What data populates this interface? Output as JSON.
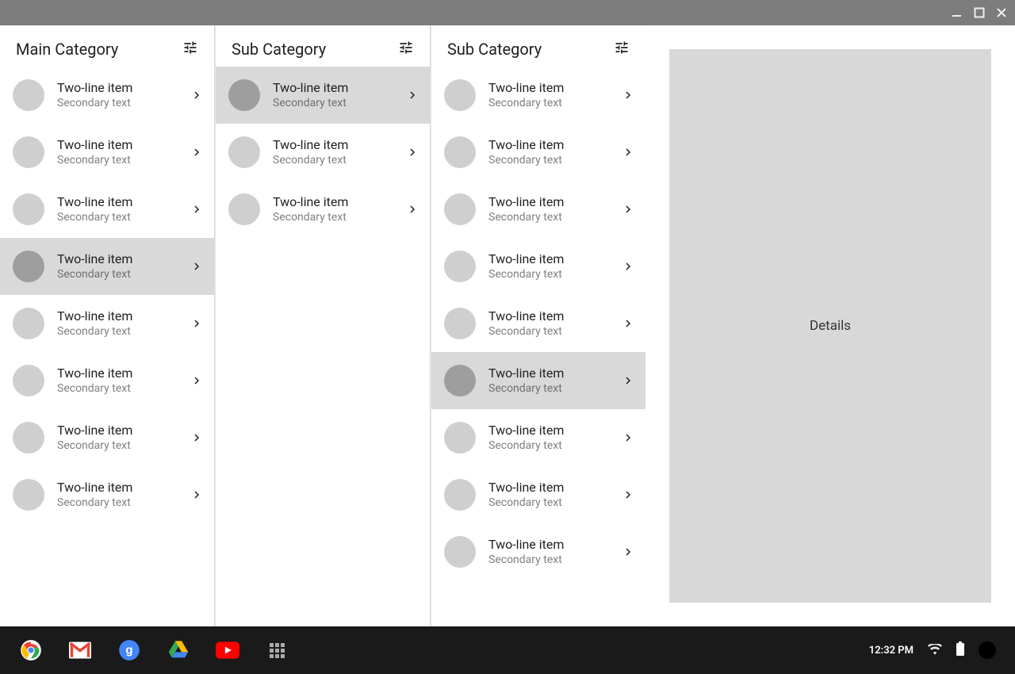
{
  "window_controls": {
    "minimize": "minimize",
    "maximize": "maximize",
    "close": "close"
  },
  "columns": [
    {
      "title": "Main Category",
      "items": [
        {
          "primary": "Two-line item",
          "secondary": "Secondary text",
          "selected": false
        },
        {
          "primary": "Two-line item",
          "secondary": "Secondary text",
          "selected": false
        },
        {
          "primary": "Two-line item",
          "secondary": "Secondary text",
          "selected": false
        },
        {
          "primary": "Two-line item",
          "secondary": "Secondary text",
          "selected": true
        },
        {
          "primary": "Two-line item",
          "secondary": "Secondary text",
          "selected": false
        },
        {
          "primary": "Two-line item",
          "secondary": "Secondary text",
          "selected": false
        },
        {
          "primary": "Two-line item",
          "secondary": "Secondary text",
          "selected": false
        },
        {
          "primary": "Two-line item",
          "secondary": "Secondary text",
          "selected": false
        }
      ]
    },
    {
      "title": "Sub Category",
      "items": [
        {
          "primary": "Two-line item",
          "secondary": "Secondary text",
          "selected": true
        },
        {
          "primary": "Two-line item",
          "secondary": "Secondary text",
          "selected": false
        },
        {
          "primary": "Two-line item",
          "secondary": "Secondary text",
          "selected": false
        }
      ]
    },
    {
      "title": "Sub Category",
      "items": [
        {
          "primary": "Two-line item",
          "secondary": "Secondary text",
          "selected": false
        },
        {
          "primary": "Two-line item",
          "secondary": "Secondary text",
          "selected": false
        },
        {
          "primary": "Two-line item",
          "secondary": "Secondary text",
          "selected": false
        },
        {
          "primary": "Two-line item",
          "secondary": "Secondary text",
          "selected": false
        },
        {
          "primary": "Two-line item",
          "secondary": "Secondary text",
          "selected": false
        },
        {
          "primary": "Two-line item",
          "secondary": "Secondary text",
          "selected": true
        },
        {
          "primary": "Two-line item",
          "secondary": "Secondary text",
          "selected": false
        },
        {
          "primary": "Two-line item",
          "secondary": "Secondary text",
          "selected": false
        },
        {
          "primary": "Two-line item",
          "secondary": "Secondary text",
          "selected": false
        }
      ]
    }
  ],
  "details_label": "Details",
  "shelf": {
    "apps": [
      "chrome",
      "gmail",
      "google",
      "drive",
      "youtube",
      "apps"
    ],
    "time": "12:32 PM"
  }
}
